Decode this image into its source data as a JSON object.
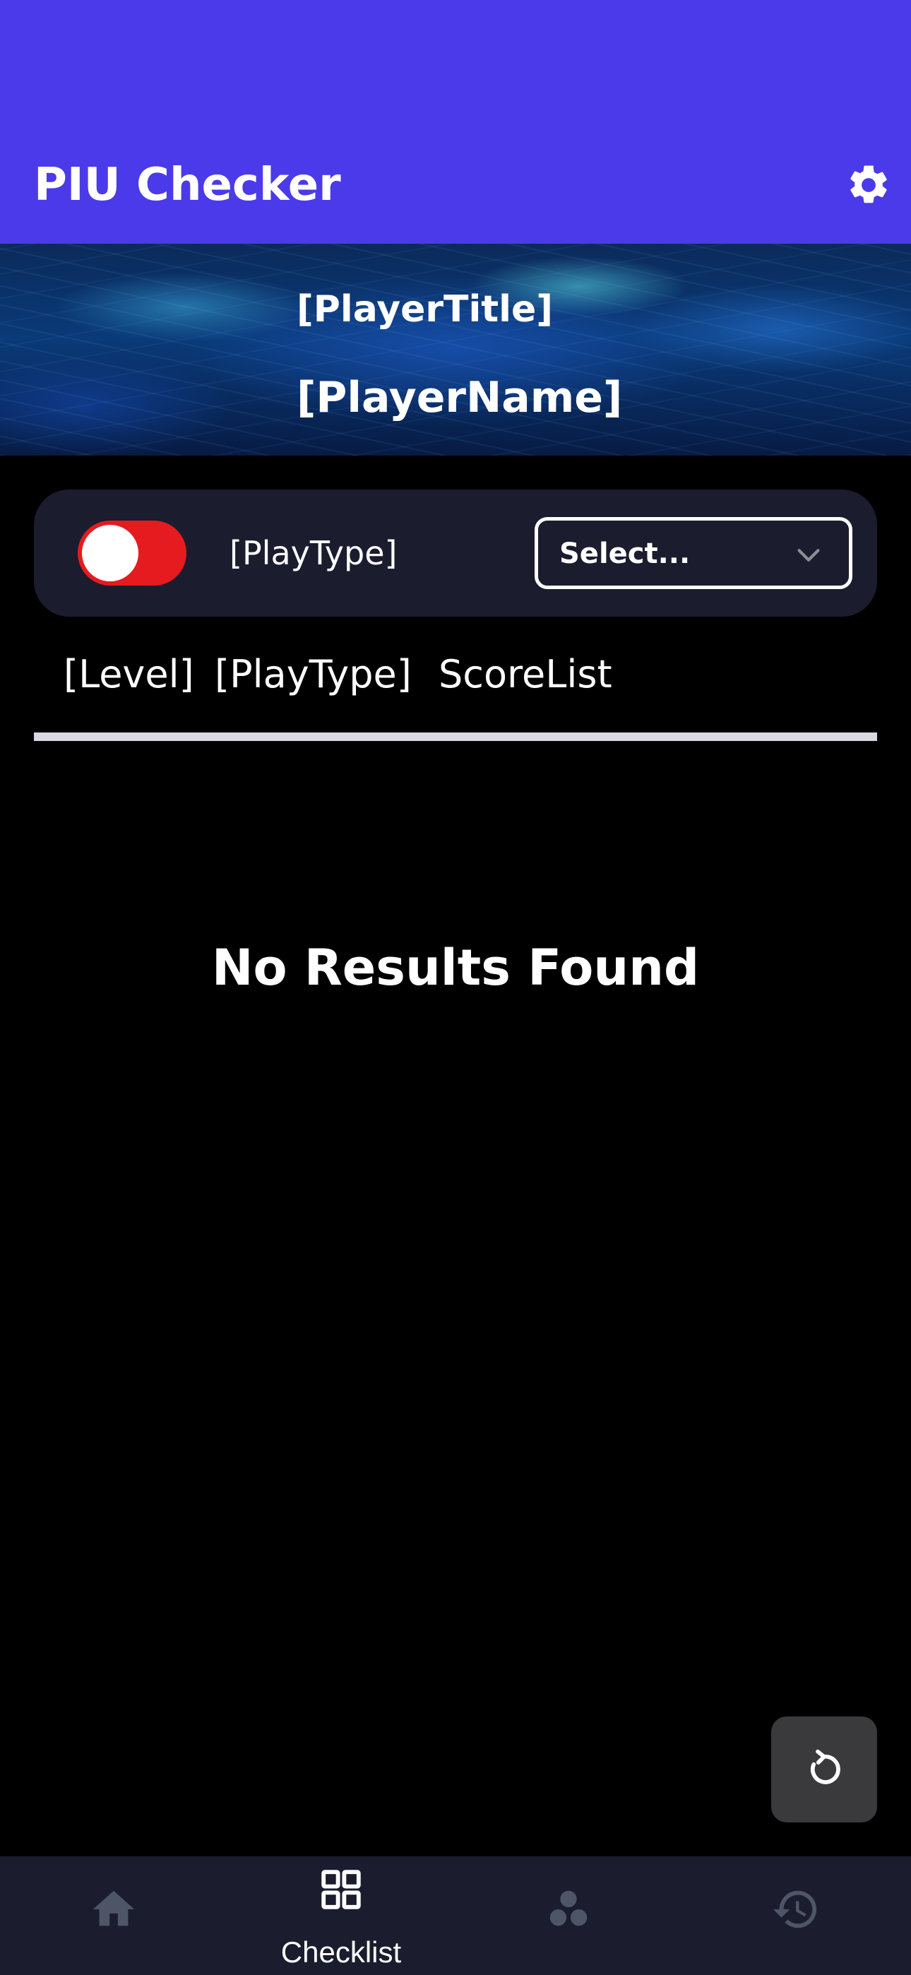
{
  "header": {
    "title": "PIU Checker",
    "settings_icon": "gear-icon",
    "background_color": "#4b3aea"
  },
  "banner": {
    "player_title": "[PlayerTitle]",
    "player_name": "[PlayerName]"
  },
  "controls": {
    "toggle_on": true,
    "toggle_color": "#e51b1f",
    "playtype_label": "[PlayType]",
    "select_value": "Select...",
    "select_icon": "chevron-down-icon"
  },
  "tabs": [
    {
      "label": "[Level]"
    },
    {
      "label": "[PlayType]"
    },
    {
      "label": "ScoreList"
    }
  ],
  "empty_state": {
    "message": "No Results Found"
  },
  "fab": {
    "icon": "refresh-icon"
  },
  "bottom_nav": {
    "items": [
      {
        "icon": "home-icon",
        "label": "",
        "active": false
      },
      {
        "icon": "grid-icon",
        "label": "Checklist",
        "active": true
      },
      {
        "icon": "group-icon",
        "label": "",
        "active": false
      },
      {
        "icon": "history-icon",
        "label": "",
        "active": false
      }
    ],
    "active_color": "#ffffff",
    "inactive_color": "#4e5567"
  }
}
